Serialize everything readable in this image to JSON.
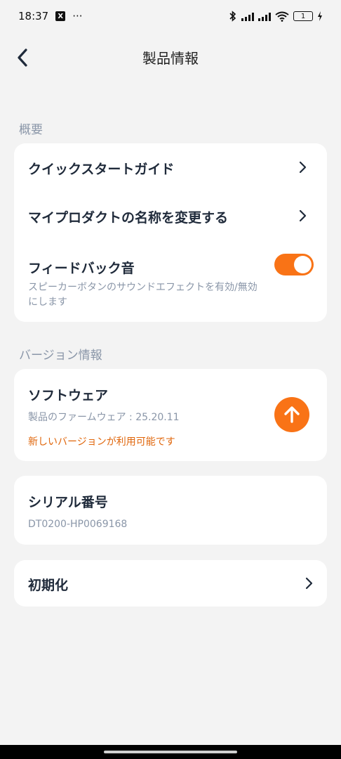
{
  "status_bar": {
    "time": "18:37",
    "x_logo": "X",
    "more": "···",
    "battery": "1",
    "icons": [
      "bluetooth-icon",
      "signal-icon",
      "signal-icon",
      "wifi-icon",
      "battery-icon",
      "charging-icon"
    ]
  },
  "header": {
    "title": "製品情報",
    "back_icon": "chevron-left-icon"
  },
  "overview": {
    "label": "概要",
    "quick_start": "クイックスタートガイド",
    "rename_product": "マイプロダクトの名称を変更する",
    "feedback_sound": {
      "title": "フィードバック音",
      "description": "スピーカーボタンのサウンドエフェクトを有効/無効にします",
      "enabled": true
    }
  },
  "version_info": {
    "label": "バージョン情報",
    "software": {
      "title": "ソフトウェア",
      "firmware": "製品のファームウェア : 25.20.11",
      "update_available": "新しいバージョンが利用可能です",
      "update_icon": "arrow-up-icon"
    }
  },
  "serial": {
    "title": "シリアル番号",
    "value": "DT0200-HP0069168"
  },
  "reset": {
    "title": "初期化"
  },
  "colors": {
    "accent": "#f97316",
    "background": "#f3f3f3",
    "card": "#ffffff",
    "muted": "#8a96a8",
    "update_text": "#e0660b"
  }
}
